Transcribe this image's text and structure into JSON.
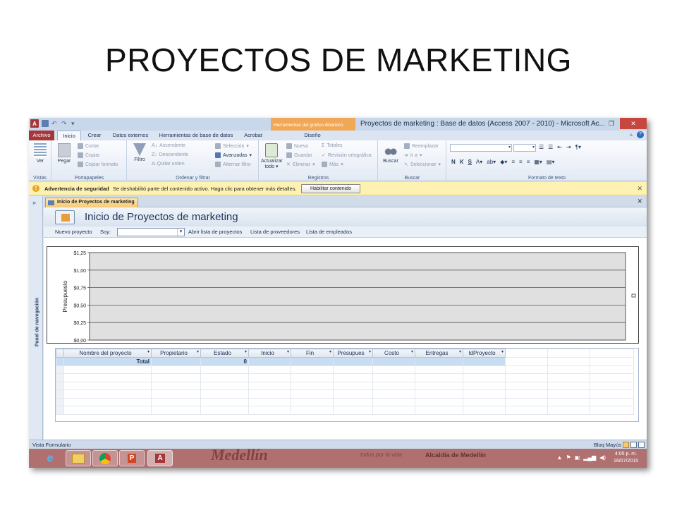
{
  "slide": {
    "title": "PROYECTOS DE MARKETING"
  },
  "window": {
    "context_tab_header": "Herramientas del gráfico dinámico",
    "title": "Proyectos de marketing : Base de datos (Access 2007 - 2010) - Microsoft Ac...",
    "buttons": {
      "minimize": "−",
      "maximize": "❐",
      "close": "✕"
    }
  },
  "tabs": [
    {
      "label": "Archivo"
    },
    {
      "label": "Inicio"
    },
    {
      "label": "Crear"
    },
    {
      "label": "Datos externos"
    },
    {
      "label": "Herramientas de base de datos"
    },
    {
      "label": "Acrobat"
    },
    {
      "label": "Diseño"
    }
  ],
  "ribbon": {
    "vistas": {
      "label": "Vistas",
      "ver": "Ver"
    },
    "portapapeles": {
      "label": "Portapapeles",
      "pegar": "Pegar",
      "cortar": "Cortar",
      "copiar": "Copiar",
      "copiar_formato": "Copiar formato"
    },
    "ordenar": {
      "label": "Ordenar y filtrar",
      "filtro": "Filtro",
      "ascendente": "Ascendente",
      "descendente": "Descendente",
      "quitar_orden": "Quitar orden",
      "seleccion": "Selección",
      "avanzadas": "Avanzadas",
      "alternar_filtro": "Alternar filtro"
    },
    "registros": {
      "label": "Registros",
      "actualizar": "Actualizar",
      "todo": "todo",
      "nuevo": "Nuevo",
      "guardar": "Guardar",
      "eliminar": "Eliminar",
      "totales": "Totales",
      "revision": "Revisión ortográfica",
      "mas": "Más"
    },
    "buscar": {
      "label": "Buscar",
      "buscar": "Buscar",
      "reemplazar": "Reemplazar",
      "ir_a": "Ir a",
      "seleccionar": "Seleccionar"
    },
    "formato": {
      "label": "Formato de texto",
      "bold": "N",
      "italic": "K",
      "underline": "S"
    }
  },
  "security_bar": {
    "title": "Advertencia de seguridad",
    "message": "Se deshabilitó parte del contenido activo. Haga clic para obtener más detalles.",
    "button": "Habilitar contenido",
    "close": "✕"
  },
  "nav_pane": {
    "label": "Panel de navegación",
    "toggle": "»"
  },
  "document_tab": {
    "label": "Inicio de Proyectos de marketing",
    "close": "✕"
  },
  "form": {
    "title": "Inicio de Proyectos de marketing",
    "toolbar": {
      "nuevo_proyecto": "Nuevo proyecto",
      "soy": "Soy:",
      "abrir_lista": "Abrir lista de proyectos",
      "lista_proveedores": "Lista de proveedores",
      "lista_empleados": "Lista de empleados"
    }
  },
  "chart_data": {
    "type": "bar",
    "ylabel": "Presupuesto",
    "ylim": [
      0,
      1.25
    ],
    "yticks": [
      "$1,25",
      "$1,00",
      "$0,75",
      "$0,50",
      "$0,25",
      "$0,00"
    ],
    "categories": [],
    "series": [],
    "grid": true,
    "plot_background": "#e0e0e0"
  },
  "datagrid": {
    "columns": [
      "Nombre del proyecto",
      "Propietario",
      "Estado",
      "Inicio",
      "Fin",
      "Presupues",
      "Costo",
      "Entregas",
      "IdProyecto"
    ],
    "total_row": {
      "label": "Total",
      "estado_value": "0"
    }
  },
  "statusbar": {
    "left": "Vista Formulario",
    "right": "Bloq Mayús"
  },
  "taskbar": {
    "bg_brand": "Medellín",
    "bg_slogan": "todos por la vida",
    "bg_org": "Alcaldía de Medellín",
    "time": "4:05 p. m.",
    "date": "16/07/2015"
  },
  "colors": {
    "file_tab": "#a4373a",
    "security_bar": "#fdf2b1",
    "context_tab": "#f0a858",
    "taskbar": "#b07070"
  }
}
